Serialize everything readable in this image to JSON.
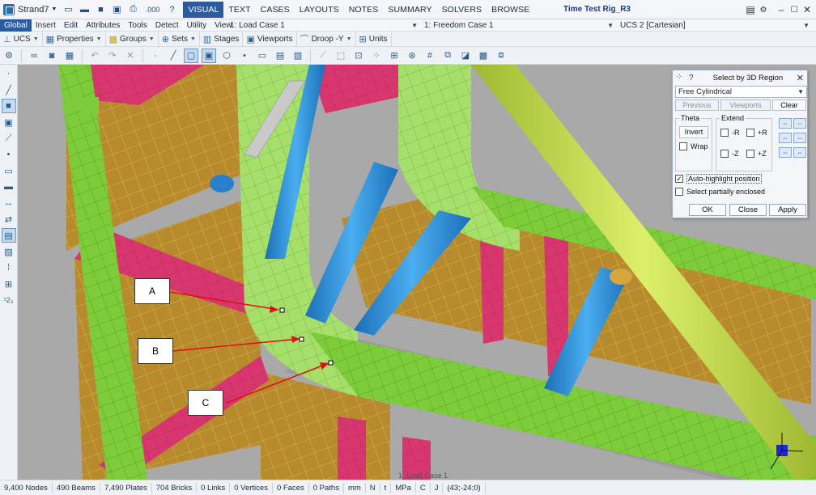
{
  "app": {
    "name": "Strand7",
    "window_title": "Time Test Rig_R3"
  },
  "quick_access": [
    "new-file-icon",
    "open-folder-icon",
    "save-icon",
    "save-as-icon",
    "print-icon"
  ],
  "quick_access_value": ".000",
  "main_tabs": [
    "VISUAL",
    "TEXT",
    "CASES",
    "LAYOUTS",
    "NOTES",
    "SUMMARY",
    "SOLVERS",
    "BROWSE"
  ],
  "active_tab": "VISUAL",
  "menu": [
    "Global",
    "Insert",
    "Edit",
    "Attributes",
    "Tools",
    "Detect",
    "Utility",
    "View"
  ],
  "combos": {
    "load_case": "1: Load Case 1",
    "freedom_case": "1: Freedom Case 1",
    "ucs": "UCS 2 [Cartesian]"
  },
  "toolbar3": [
    {
      "label": "UCS",
      "icon": "ucs-icon"
    },
    {
      "label": "Properties",
      "icon": "properties-icon"
    },
    {
      "label": "Groups",
      "icon": "groups-icon"
    },
    {
      "label": "Sets",
      "icon": "sets-icon"
    },
    {
      "label": "Stages",
      "icon": "stages-icon"
    },
    {
      "label": "Viewports",
      "icon": "viewports-icon"
    },
    {
      "label": "Droop -Y",
      "icon": "droop-icon"
    },
    {
      "label": "Units",
      "icon": "units-icon"
    }
  ],
  "callouts": [
    "A",
    "B",
    "C"
  ],
  "dialog": {
    "title": "Select by 3D Region",
    "help": "?",
    "region_type": "Free Cylindrical",
    "previous": "Previous",
    "viewports": "Viewports",
    "clear": "Clear",
    "theta_title": "Theta",
    "invert": "Invert",
    "wrap": "Wrap",
    "extend_title": "Extend",
    "minus_r": "-R",
    "plus_r": "+R",
    "minus_z": "-Z",
    "plus_z": "+Z",
    "auto_highlight": "Auto-highlight position",
    "partially_enclosed": "Select partially enclosed",
    "ok": "OK",
    "close": "Close",
    "apply": "Apply",
    "auto_highlight_checked": true,
    "partially_enclosed_checked": false
  },
  "viewport_label": "1: Load Case 1",
  "status": [
    "9,400 Nodes",
    "490 Beams",
    "7,490 Plates",
    "704 Bricks",
    "0 Links",
    "0 Vertices",
    "0 Faces",
    "0 Paths",
    "mm",
    "N",
    "t",
    "MPa",
    "C",
    "J",
    "(43;-24;0)"
  ],
  "colors": {
    "accent": "#2c5aa0",
    "plate_green": "#7dcd3a",
    "plate_brown": "#b88a2e",
    "plate_pink": "#d8366e",
    "beam_blue": "#2f8fd8",
    "beam_yellow": "#c7de4a"
  }
}
